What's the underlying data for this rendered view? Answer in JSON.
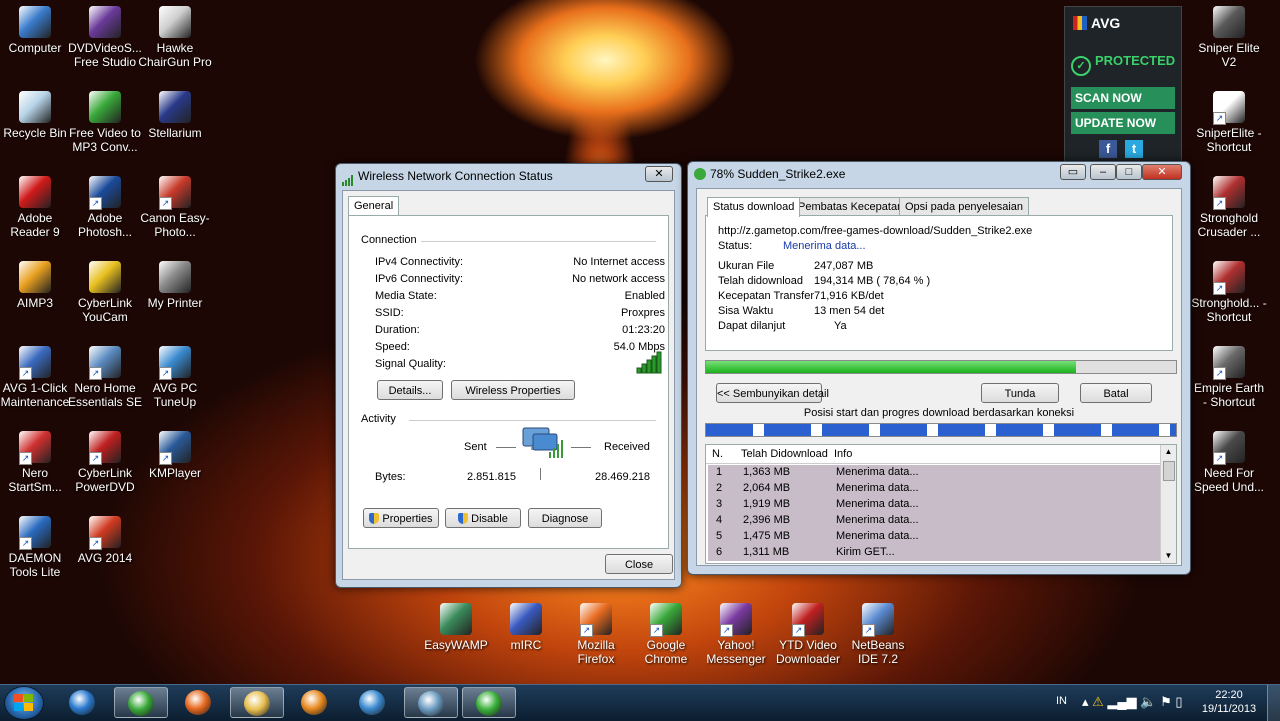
{
  "desktop_icons_left": [
    {
      "label": "Computer",
      "color": "#3a7ccc",
      "shortcut": false
    },
    {
      "label": "DVDVideoS... Free Studio",
      "color": "#6a3a9a",
      "shortcut": false
    },
    {
      "label": "Hawke ChairGun Pro",
      "color": "#cfcfcf",
      "shortcut": false
    },
    {
      "label": "Recycle Bin",
      "color": "#b8d4e8",
      "shortcut": false
    },
    {
      "label": "Free Video to MP3 Conv...",
      "color": "#3aa83a",
      "shortcut": false
    },
    {
      "label": "Stellarium",
      "color": "#2a3a8a",
      "shortcut": false
    },
    {
      "label": "Adobe Reader 9",
      "color": "#d01a1a",
      "shortcut": false
    },
    {
      "label": "Adobe Photosh...",
      "color": "#1a4a9a",
      "shortcut": true
    },
    {
      "label": "Canon Easy-Photo...",
      "color": "#c83a2a",
      "shortcut": true
    },
    {
      "label": "AIMP3",
      "color": "#e8a020",
      "shortcut": false
    },
    {
      "label": "CyberLink YouCam",
      "color": "#e8c020",
      "shortcut": false
    },
    {
      "label": "My Printer",
      "color": "#8a8a8a",
      "shortcut": false
    },
    {
      "label": "AVG 1-Click Maintenance",
      "color": "#3a6ac0",
      "shortcut": true
    },
    {
      "label": "Nero Home Essentials SE",
      "color": "#5a8ac0",
      "shortcut": true
    },
    {
      "label": "AVG PC TuneUp",
      "color": "#3a8ad0",
      "shortcut": true
    },
    {
      "label": "Nero StartSm...",
      "color": "#d03030",
      "shortcut": true
    },
    {
      "label": "CyberLink PowerDVD",
      "color": "#c02020",
      "shortcut": true
    },
    {
      "label": "KMPlayer",
      "color": "#2a5a9a",
      "shortcut": true
    },
    {
      "label": "DAEMON Tools Lite",
      "color": "#2a6ac0",
      "shortcut": true
    },
    {
      "label": "AVG 2014",
      "color": "#d03a20",
      "shortcut": true
    }
  ],
  "desktop_icons_bottom": [
    {
      "label": "EasyWAMP",
      "color": "#3a8a5a",
      "shortcut": false
    },
    {
      "label": "mIRC",
      "color": "#3a5ac0",
      "shortcut": false
    },
    {
      "label": "Mozilla Firefox",
      "color": "#e86a20",
      "shortcut": true
    },
    {
      "label": "Google Chrome",
      "color": "#3aa83a",
      "shortcut": true
    },
    {
      "label": "Yahoo! Messenger",
      "color": "#7a3aa0",
      "shortcut": true
    },
    {
      "label": "YTD Video Downloader",
      "color": "#c02020",
      "shortcut": true
    },
    {
      "label": "NetBeans IDE 7.2",
      "color": "#5a8ad0",
      "shortcut": true
    }
  ],
  "desktop_icons_right": [
    {
      "label": "Sniper Elite V2",
      "color": "#5a5a5a",
      "shortcut": false
    },
    {
      "label": "SniperElite - Shortcut",
      "color": "#ffffff",
      "shortcut": true
    },
    {
      "label": "Stronghold Crusader ...",
      "color": "#b03030",
      "shortcut": true
    },
    {
      "label": "Stronghold... - Shortcut",
      "color": "#b03030",
      "shortcut": true
    },
    {
      "label": "Empire Earth - Shortcut",
      "color": "#6a6a6a",
      "shortcut": true
    },
    {
      "label": "Need For Speed Und...",
      "color": "#4a4a4a",
      "shortcut": true
    }
  ],
  "avg": {
    "brand": "AVG",
    "status": "PROTECTED",
    "scan_label": "SCAN NOW",
    "update_label": "UPDATE NOW",
    "facebook": "f",
    "twitter": "t"
  },
  "wireless": {
    "title": "Wireless Network Connection Status",
    "tab": "General",
    "connection_heading": "Connection",
    "rows": [
      {
        "key": "IPv4 Connectivity:",
        "value": "No Internet access"
      },
      {
        "key": "IPv6 Connectivity:",
        "value": "No network access"
      },
      {
        "key": "Media State:",
        "value": "Enabled"
      },
      {
        "key": "SSID:",
        "value": "Proxpres"
      },
      {
        "key": "Duration:",
        "value": "01:23:20"
      },
      {
        "key": "Speed:",
        "value": "54.0 Mbps"
      }
    ],
    "signal_label": "Signal Quality:",
    "signal_bars": 5,
    "details_label": "Details...",
    "wireless_props_label": "Wireless Properties",
    "activity_heading": "Activity",
    "sent_label": "Sent",
    "received_label": "Received",
    "bytes_label": "Bytes:",
    "bytes_sent": "2.851.815",
    "bytes_received": "28.469.218",
    "properties_label": "Properties",
    "disable_label": "Disable",
    "diagnose_label": "Diagnose",
    "close_label": "Close"
  },
  "download": {
    "title": "78% Sudden_Strike2.exe",
    "tabs": [
      "Status download",
      "Pembatas Kecepatan",
      "Opsi pada penyelesaian"
    ],
    "url": "http://z.gametop.com/free-games-download/Sudden_Strike2.exe",
    "status_label": "Status:",
    "status_value": "Menerima data...",
    "rows": [
      {
        "key": "Ukuran File",
        "value": "247,087  MB"
      },
      {
        "key": "Telah didownload",
        "value": "194,314  MB  ( 78,64 % )"
      },
      {
        "key": "Kecepatan Transfer",
        "value": "71,916  KB/det"
      },
      {
        "key": "Sisa Waktu",
        "value": "13 men 54 det"
      },
      {
        "key": "Dapat dilanjut",
        "value": "Ya"
      }
    ],
    "progress_fraction": 0.7864,
    "hide_label": "<< Sembunyikan detail",
    "pause_label": "Tunda",
    "cancel_label": "Batal",
    "segments_caption": "Posisi start dan progres download berdasarkan koneksi",
    "table_headers": [
      "N.",
      "Telah Didownload",
      "Info"
    ],
    "connections": [
      {
        "n": "1",
        "downloaded": "1,363  MB",
        "info": "Menerima data..."
      },
      {
        "n": "2",
        "downloaded": "2,064  MB",
        "info": "Menerima data..."
      },
      {
        "n": "3",
        "downloaded": "1,919  MB",
        "info": "Menerima data..."
      },
      {
        "n": "4",
        "downloaded": "2,396  MB",
        "info": "Menerima data..."
      },
      {
        "n": "5",
        "downloaded": "1,475  MB",
        "info": "Menerima data..."
      },
      {
        "n": "6",
        "downloaded": "1,311  MB",
        "info": "Kirim GET..."
      }
    ]
  },
  "taskbar": {
    "buttons": [
      {
        "name": "internet-explorer",
        "color": "#2a7ad0",
        "open": false
      },
      {
        "name": "chrome",
        "color": "#3aa83a",
        "open": true
      },
      {
        "name": "firefox",
        "color": "#e86a20",
        "open": false
      },
      {
        "name": "explorer",
        "color": "#e8c050",
        "open": true
      },
      {
        "name": "media-player",
        "color": "#e88a20",
        "open": false
      },
      {
        "name": "avg-tuneup",
        "color": "#3a8ad0",
        "open": false
      },
      {
        "name": "network-center",
        "color": "#6a9ac0",
        "open": true
      },
      {
        "name": "internet-download-manager",
        "color": "#3ab03a",
        "open": true
      }
    ],
    "language": "IN",
    "time": "22:20",
    "date": "19/11/2013"
  }
}
